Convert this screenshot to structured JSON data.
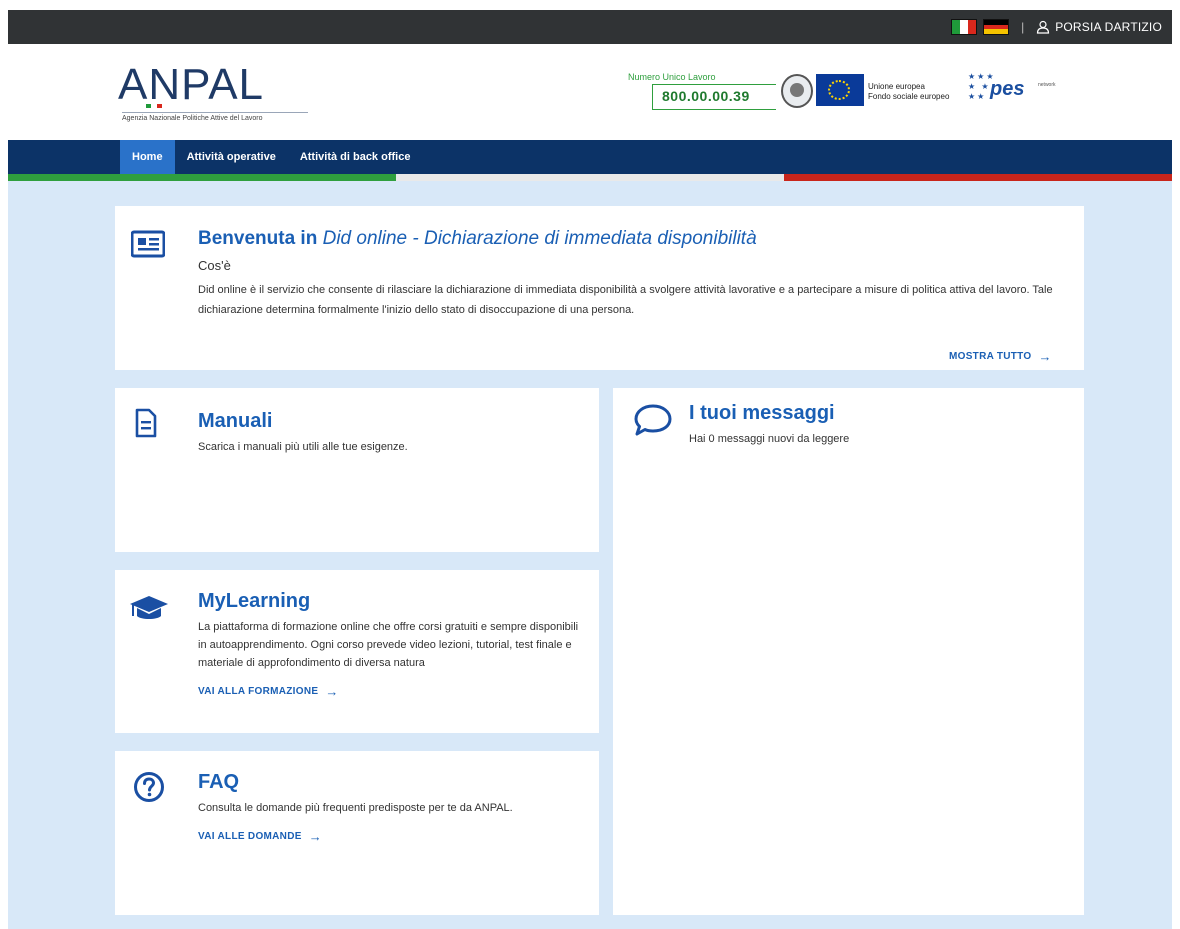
{
  "topbar": {
    "user_name": "PORSIA DARTIZIO",
    "separator": "|"
  },
  "header": {
    "logo_text": "ANPAL",
    "logo_subtitle": "Agenzia Nazionale Politiche Attive del Lavoro",
    "numero_unico_label": "Numero Unico Lavoro",
    "numero_unico_value": "800.00.00.39",
    "eu_text_line1": "Unione europea",
    "eu_text_line2": "Fondo sociale europeo",
    "pes_text": "pes",
    "pes_small": "network"
  },
  "nav": {
    "items": [
      {
        "label": "Home",
        "active": true
      },
      {
        "label": "Attività operative",
        "active": false
      },
      {
        "label": "Attività di back office",
        "active": false
      }
    ]
  },
  "welcome": {
    "title_bold": "Benvenuta in",
    "title_italic": "Did online - Dichiarazione di immediata disponibilità",
    "subtitle": "Cos'è",
    "description": "Did online è il servizio che consente di rilasciare la dichiarazione di immediata disponibilità a svolgere attività lavorative e a partecipare a misure di politica attiva del lavoro. Tale dichiarazione determina formalmente l'inizio dello stato di disoccupazione di una persona.",
    "link": "MOSTRA TUTTO"
  },
  "manuali": {
    "title": "Manuali",
    "text": "Scarica i manuali più utili alle tue esigenze."
  },
  "mylearning": {
    "title": "MyLearning",
    "text": "La piattaforma di formazione online che offre corsi gratuiti e sempre disponibili in autoapprendimento. Ogni corso prevede video lezioni, tutorial, test finale e materiale di approfondimento di diversa natura",
    "link": "VAI ALLA FORMAZIONE"
  },
  "faq": {
    "title": "FAQ",
    "text": "Consulta le domande più frequenti predisposte per te da ANPAL.",
    "link": "VAI ALLE DOMANDE"
  },
  "messaggi": {
    "title": "I tuoi messaggi",
    "text": "Hai 0 messaggi nuovi da leggere"
  },
  "colors": {
    "nav_bg": "#0c3367",
    "nav_active": "#2a72c9",
    "accent": "#1a5fb4",
    "page_bg": "#d8e8f8",
    "green": "#2f9f3e",
    "red": "#c8251b"
  }
}
